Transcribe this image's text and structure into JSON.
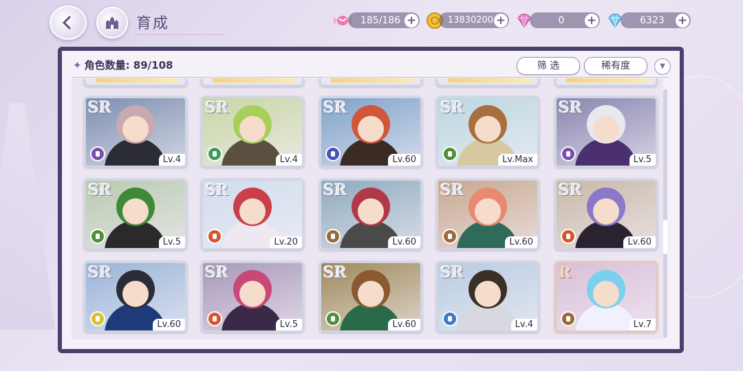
{
  "header": {
    "title": "育成"
  },
  "resources": [
    {
      "name": "stamina",
      "icon": "candy-icon",
      "value": "185/186"
    },
    {
      "name": "gold",
      "icon": "coin-icon",
      "value": "13830200"
    },
    {
      "name": "gem_paid",
      "icon": "pink-diamond-icon",
      "value": "0"
    },
    {
      "name": "gem_free",
      "icon": "blue-diamond-icon",
      "value": "6323"
    }
  ],
  "panel": {
    "count_label": "角色数量: 89/108",
    "filter_label": "筛 选",
    "sort_label": "稀有度"
  },
  "cards": [
    {
      "rarity": "SR",
      "level": "Lv.4",
      "class_color": "#7b4fb0",
      "hair": "#c7a9b0",
      "outfit": "#2c2c34",
      "bg": "#7d8fb0"
    },
    {
      "rarity": "SR",
      "level": "Lv.4",
      "class_color": "#3f9a56",
      "hair": "#a7cf5a",
      "outfit": "#5a5040",
      "bg": "#c9d6a4"
    },
    {
      "rarity": "SR",
      "level": "Lv.60",
      "class_color": "#4a55b8",
      "hair": "#d0573a",
      "outfit": "#3a2c24",
      "bg": "#7fa3c8"
    },
    {
      "rarity": "SR",
      "level": "Lv.Max",
      "class_color": "#4e8f3a",
      "hair": "#a8703e",
      "outfit": "#d8c8a0",
      "bg": "#bcd7e0"
    },
    {
      "rarity": "SR",
      "level": "Lv.5",
      "class_color": "#7b4fb0",
      "hair": "#e8e8ee",
      "outfit": "#4a3070",
      "bg": "#8a86b0"
    },
    {
      "rarity": "SR",
      "level": "Lv.5",
      "class_color": "#4e8f3a",
      "hair": "#3f8a3a",
      "outfit": "#2a2a2a",
      "bg": "#b9c9b0"
    },
    {
      "rarity": "SR",
      "level": "Lv.20",
      "class_color": "#d8542e",
      "hair": "#c84048",
      "outfit": "#f0e8f0",
      "bg": "#d0dcec"
    },
    {
      "rarity": "SR",
      "level": "Lv.60",
      "class_color": "#9a6a3a",
      "hair": "#b03848",
      "outfit": "#4a4a4a",
      "bg": "#8faabe"
    },
    {
      "rarity": "SR",
      "level": "Lv.60",
      "class_color": "#9a6a3a",
      "hair": "#e88a70",
      "outfit": "#2f6a5a",
      "bg": "#c8a890"
    },
    {
      "rarity": "SR",
      "level": "Lv.60",
      "class_color": "#d8542e",
      "hair": "#8a78c8",
      "outfit": "#2a2230",
      "bg": "#c8b8a8"
    },
    {
      "rarity": "SR",
      "level": "Lv.60",
      "class_color": "#d8c428",
      "hair": "#2c2c38",
      "outfit": "#1e3a78",
      "bg": "#9ab4d8"
    },
    {
      "rarity": "SR",
      "level": "Lv.5",
      "class_color": "#d8542e",
      "hair": "#c84878",
      "outfit": "#3a2a48",
      "bg": "#a898b8"
    },
    {
      "rarity": "SR",
      "level": "Lv.60",
      "class_color": "#4e8f3a",
      "hair": "#8a5a30",
      "outfit": "#2a6a48",
      "bg": "#a08a5a"
    },
    {
      "rarity": "SR",
      "level": "Lv.4",
      "class_color": "#3a7ac8",
      "hair": "#3a3028",
      "outfit": "#d8d8e0",
      "bg": "#b8cce0"
    },
    {
      "rarity": "R",
      "level": "Lv.7",
      "class_color": "#9a6a3a",
      "hair": "#7ad0f0",
      "outfit": "#f0f0ff",
      "bg": "#d8c0d8"
    }
  ]
}
